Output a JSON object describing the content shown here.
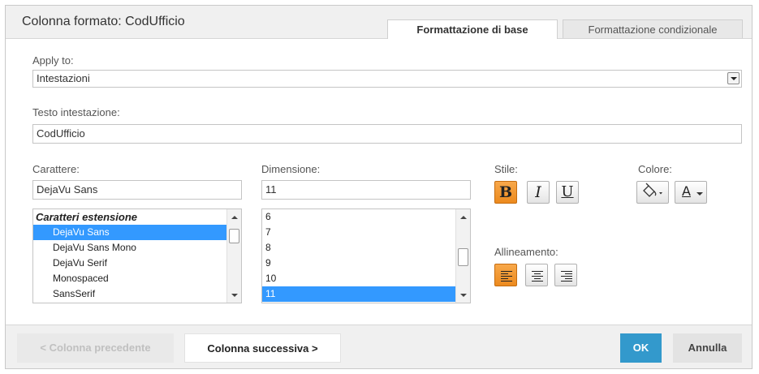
{
  "dialog": {
    "title": "Colonna formato: CodUfficio",
    "tabs": [
      {
        "label": "Formattazione di base",
        "active": true
      },
      {
        "label": "Formattazione condizionale",
        "active": false
      }
    ]
  },
  "apply_to": {
    "label": "Apply to:",
    "value": "Intestazioni"
  },
  "header_text": {
    "label": "Testo intestazione:",
    "value": "CodUfficio"
  },
  "font": {
    "label": "Carattere:",
    "value": "DejaVu Sans",
    "list": [
      {
        "text": "Caratteri estensione",
        "kind": "header"
      },
      {
        "text": "DejaVu Sans",
        "selected": true
      },
      {
        "text": "DejaVu Sans Mono"
      },
      {
        "text": "DejaVu Serif"
      },
      {
        "text": "Monospaced"
      },
      {
        "text": "SansSerif"
      }
    ]
  },
  "size": {
    "label": "Dimensione:",
    "value": "11",
    "list": [
      "6",
      "7",
      "8",
      "9",
      "10",
      "11"
    ],
    "selected": "11"
  },
  "style": {
    "label": "Stile:",
    "bold": {
      "glyph": "B",
      "active": true
    },
    "italic": {
      "glyph": "I",
      "active": false
    },
    "underline": {
      "glyph": "U",
      "active": false
    }
  },
  "color": {
    "label": "Colore:",
    "fill_icon": "paint-bucket-icon",
    "text_glyph": "A"
  },
  "alignment": {
    "label": "Allineamento:",
    "active": "left"
  },
  "footer": {
    "prev_label": "< Colonna precedente",
    "next_label": "Colonna successiva >",
    "ok_label": "OK",
    "cancel_label": "Annulla"
  },
  "colors": {
    "accent_orange": "#ec8a1e",
    "selection_blue": "#3399ff",
    "ok_blue": "#3399cc"
  }
}
